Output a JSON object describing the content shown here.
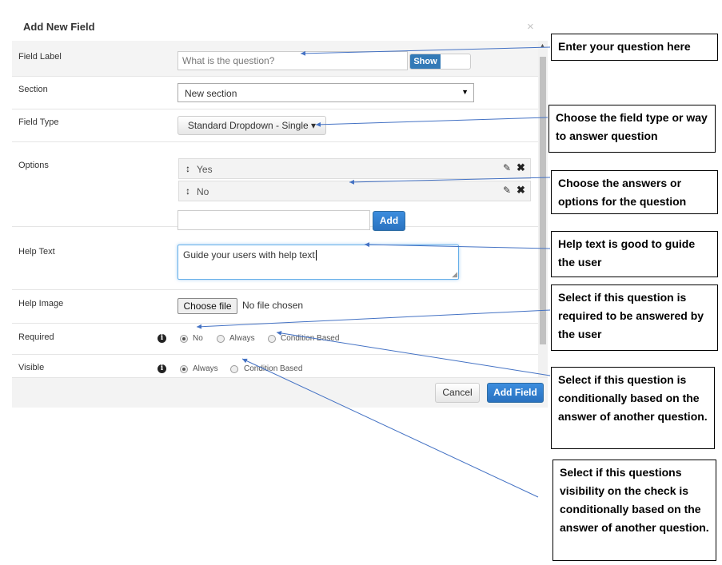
{
  "modal": {
    "title": "Add New Field",
    "close_glyph": "×"
  },
  "fields": {
    "field_label": {
      "label": "Field Label",
      "placeholder": "What is the question?",
      "toggle_label": "Show"
    },
    "section": {
      "label": "Section",
      "selected": "New section",
      "caret": "▼"
    },
    "field_type": {
      "label": "Field Type",
      "button_label": "Standard Dropdown - Single",
      "caret": "▾"
    },
    "options": {
      "label": "Options",
      "items": [
        {
          "label": "Yes"
        },
        {
          "label": "No"
        }
      ],
      "handle_glyph": "↕",
      "edit_glyph": "✎",
      "delete_glyph": "✖",
      "new_option_value": "",
      "add_label": "Add"
    },
    "help_text": {
      "label": "Help Text",
      "value": "Guide your users with help text",
      "grip": "◢"
    },
    "help_image": {
      "label": "Help Image",
      "button_label": "Choose file",
      "status": "No file chosen"
    },
    "required": {
      "label": "Required",
      "info_glyph": "i",
      "options": [
        "No",
        "Always",
        "Condition Based"
      ],
      "selected": "No"
    },
    "visible": {
      "label": "Visible",
      "info_glyph": "i",
      "options": [
        "Always",
        "Condition Based"
      ],
      "selected": "Always"
    }
  },
  "footer": {
    "cancel_label": "Cancel",
    "submit_label": "Add Field"
  },
  "annotations": [
    {
      "text": "Enter your question here"
    },
    {
      "text": "Choose the field type or way to answer question"
    },
    {
      "text": "Choose the answers or options for the question"
    },
    {
      "text": "Help text is good to guide the user"
    },
    {
      "text": "Select if this question is required to be answered by the user"
    },
    {
      "text": "Select if this question is conditionally based on the answer of another question."
    },
    {
      "text": "Select if this questions visibility on the check is conditionally based on the answer of another question."
    }
  ],
  "colors": {
    "primary": "#2a72c0",
    "arrow": "#4472c4",
    "toggle_on": "#337ab7",
    "focus_border": "#66afe9"
  }
}
